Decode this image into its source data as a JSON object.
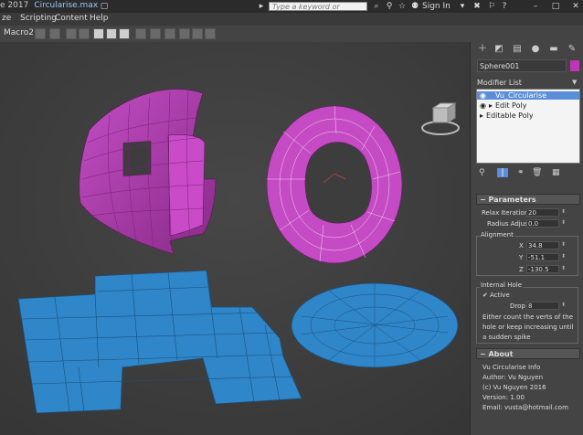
{
  "titlebar": {
    "app": "e 2017",
    "file": "Circularise.max",
    "search_placeholder": "Type a keyword or phrase",
    "signin": "Sign In"
  },
  "menu": {
    "items": [
      "ze",
      "Scripting",
      "Content",
      "Help"
    ]
  },
  "toolbar": {
    "macro_label": "Macro2"
  },
  "panel": {
    "object_name": "Sphere001",
    "object_color": "#c035b8",
    "modifier_list_label": "Modifier List",
    "stack": [
      "Vu_Circularise",
      "Edit Poly",
      "Editable Poly"
    ],
    "params_title": "Parameters",
    "relax_label": "Relax Iterations",
    "relax_value": "20",
    "radius_label": "Radius Adjust",
    "radius_value": "0.0",
    "alignment_label": "Alignment",
    "x_label": "X",
    "x_value": "34.8",
    "y_label": "Y",
    "y_value": "-51.1",
    "z_label": "Z",
    "z_value": "-130.5",
    "hole_label": "Internal Hole",
    "active_label": "Active",
    "drop_label": "Drop",
    "drop_value": "8",
    "hole_text": [
      "Either count the verts of the",
      "hole or keep increasing until",
      "a sudden spike"
    ],
    "about_title": "About",
    "about_lines": [
      "Vu Circularise Info",
      "Author: Vu Nguyen",
      "(c) Vu Nguyen 2016",
      "Version: 1.00",
      "Email: vusta@hotmail.com"
    ]
  }
}
